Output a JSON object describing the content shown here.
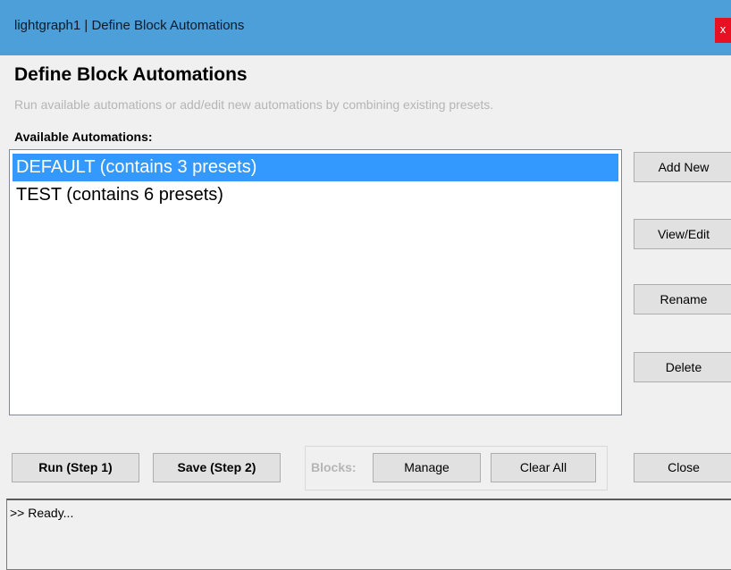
{
  "window": {
    "title": "lightgraph1 | Define Block Automations",
    "close_glyph": "x"
  },
  "header": {
    "title": "Define Block Automations",
    "subtitle": "Run available automations or add/edit new automations by combining existing presets."
  },
  "automations": {
    "label": "Available Automations:",
    "items": [
      {
        "label": "DEFAULT (contains 3 presets)",
        "selected": true
      },
      {
        "label": "TEST (contains 6 presets)",
        "selected": false
      }
    ]
  },
  "side_buttons": {
    "add_new": "Add New",
    "view_edit": "View/Edit",
    "rename": "Rename",
    "delete": "Delete"
  },
  "bottom": {
    "run": "Run (Step 1)",
    "save": "Save (Step 2)",
    "blocks_label": "Blocks:",
    "manage": "Manage",
    "clear_all": "Clear All",
    "close": "Close"
  },
  "status": {
    "text": ">> Ready..."
  },
  "colors": {
    "titlebar": "#4c9fd9",
    "selection": "#3399ff",
    "close_button": "#e81123"
  }
}
